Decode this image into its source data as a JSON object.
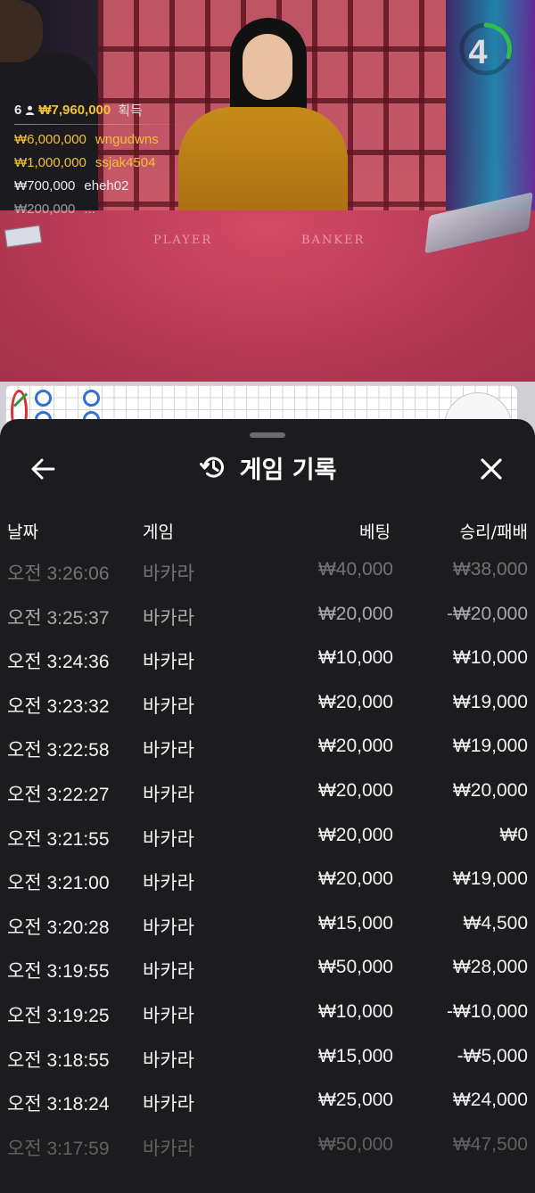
{
  "video": {
    "table_labels": {
      "player": "PLAYER",
      "banker": "BANKER"
    },
    "timer": {
      "value": "4",
      "color": "#2fbf4a"
    },
    "winners": {
      "count": "6",
      "total": "₩7,960,000",
      "label": "획득",
      "entries": [
        {
          "amount": "₩6,000,000",
          "name": "wngudwns"
        },
        {
          "amount": "₩1,000,000",
          "name": "ssjak4504"
        },
        {
          "amount": "₩700,000",
          "name": "eheh02"
        },
        {
          "amount": "₩200,000",
          "name": "..."
        }
      ]
    }
  },
  "history": {
    "title": "게임 기록",
    "back_icon": "arrow-left-icon",
    "history_icon": "history-clock-icon",
    "close_icon": "close-x-icon",
    "columns": {
      "date": "날짜",
      "game": "게임",
      "bet": "베팅",
      "result": "승리/패배"
    },
    "rows": [
      {
        "time": "오전 3:26:06",
        "game": "바카라",
        "bet": "₩40,000",
        "result": "₩38,000"
      },
      {
        "time": "오전 3:25:37",
        "game": "바카라",
        "bet": "₩20,000",
        "result": "-₩20,000"
      },
      {
        "time": "오전 3:24:36",
        "game": "바카라",
        "bet": "₩10,000",
        "result": "₩10,000"
      },
      {
        "time": "오전 3:23:32",
        "game": "바카라",
        "bet": "₩20,000",
        "result": "₩19,000"
      },
      {
        "time": "오전 3:22:58",
        "game": "바카라",
        "bet": "₩20,000",
        "result": "₩19,000"
      },
      {
        "time": "오전 3:22:27",
        "game": "바카라",
        "bet": "₩20,000",
        "result": "₩20,000"
      },
      {
        "time": "오전 3:21:55",
        "game": "바카라",
        "bet": "₩20,000",
        "result": "₩0"
      },
      {
        "time": "오전 3:21:00",
        "game": "바카라",
        "bet": "₩20,000",
        "result": "₩19,000"
      },
      {
        "time": "오전 3:20:28",
        "game": "바카라",
        "bet": "₩15,000",
        "result": "₩4,500"
      },
      {
        "time": "오전 3:19:55",
        "game": "바카라",
        "bet": "₩50,000",
        "result": "₩28,000"
      },
      {
        "time": "오전 3:19:25",
        "game": "바카라",
        "bet": "₩10,000",
        "result": "-₩10,000"
      },
      {
        "time": "오전 3:18:55",
        "game": "바카라",
        "bet": "₩15,000",
        "result": "-₩5,000"
      },
      {
        "time": "오전 3:18:24",
        "game": "바카라",
        "bet": "₩25,000",
        "result": "₩24,000"
      },
      {
        "time": "오전 3:17:59",
        "game": "바카라",
        "bet": "₩50,000",
        "result": "₩47,500"
      }
    ]
  }
}
